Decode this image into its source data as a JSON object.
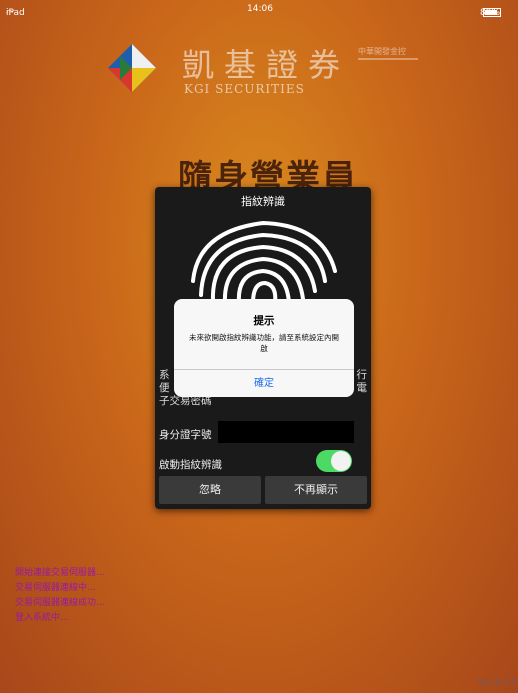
{
  "status_bar": {
    "device": "iPad",
    "time": "14:06",
    "battery": "89%"
  },
  "brand": {
    "name_cn": "凱基證券",
    "name_en": "KGI SECURITIES",
    "group": "中華開發金控"
  },
  "app_title": "隨身營業員",
  "fingerprint_dialog": {
    "title": "指紋辨識",
    "message_parts": [
      "系",
      "行",
      "便",
      "電",
      "子交易密碼"
    ],
    "id_label": "身分證字號",
    "id_value": "",
    "toggle_label": "啟動指紋辨識",
    "toggle_on": true,
    "skip_label": "忽略",
    "no_more_label": "不再顯示"
  },
  "alert": {
    "title": "提示",
    "message": "未來欲開啟指紋辨識功能，請至系統設定內開啟",
    "ok_label": "確定"
  },
  "log_lines": [
    "開始連接交易伺服器...",
    "交易伺服器連線中...",
    "交易伺服器連線成功...",
    "登入系統中..."
  ],
  "version": "V1.9.17.",
  "colors": {
    "toggle_on": "#4cd964",
    "alert_button": "#1a6ee8",
    "log_text": "#9a1aa0"
  }
}
